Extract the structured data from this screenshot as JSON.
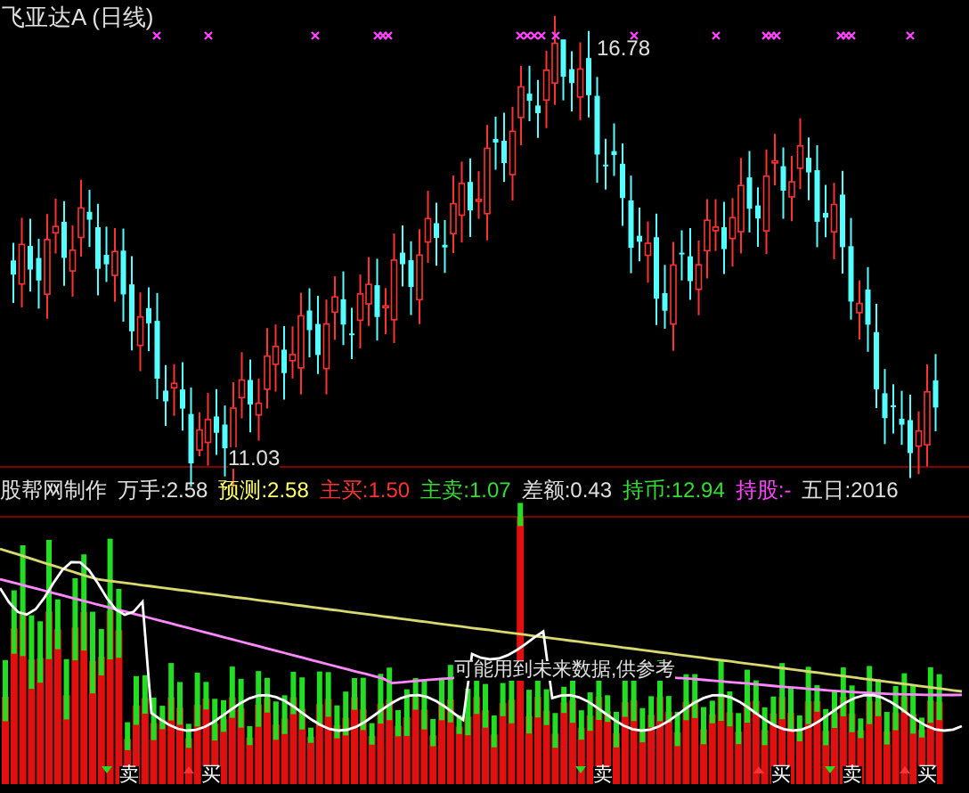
{
  "title": "飞亚达A (日线)",
  "price_chart": {
    "high_label": "16.78",
    "low_label": "11.03"
  },
  "indicator_line": [
    {
      "text": "股帮网制作",
      "color": "#e0e0e0"
    },
    {
      "text": "万手:2.58",
      "color": "#e0e0e0"
    },
    {
      "text": "预测:2.58",
      "color": "#ffff66"
    },
    {
      "text": "主买:1.50",
      "color": "#ff3333"
    },
    {
      "text": "主卖:1.07",
      "color": "#33dd33"
    },
    {
      "text": "差额:0.43",
      "color": "#e0e0e0"
    },
    {
      "text": "持币:12.94",
      "color": "#33dd33"
    },
    {
      "text": "持股:-",
      "color": "#ff44ff"
    },
    {
      "text": "五日:2016",
      "color": "#e0e0e0"
    }
  ],
  "note": "可能用到未来数据,供参考",
  "signals": [
    {
      "kind": "sell",
      "label": "卖"
    },
    {
      "kind": "buy",
      "label": "买"
    },
    {
      "kind": "sell",
      "label": "卖"
    },
    {
      "kind": "buy",
      "label": "买"
    },
    {
      "kind": "sell",
      "label": "卖"
    },
    {
      "kind": "buy",
      "label": "买"
    }
  ]
}
